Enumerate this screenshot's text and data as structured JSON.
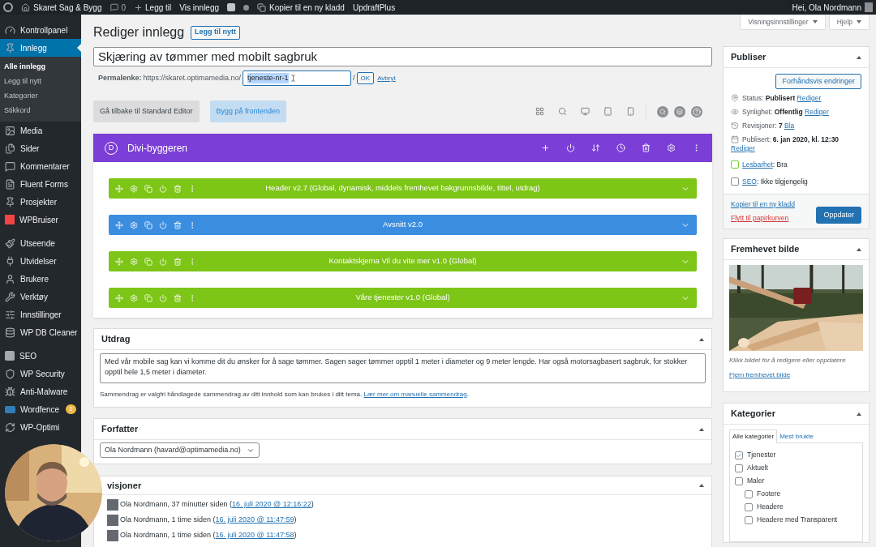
{
  "admin_bar": {
    "site": "Skaret Sag & Bygg",
    "comments": "0",
    "new": "Legg til",
    "view": "Vis innlegg",
    "copy": "Kopier til en ny kladd",
    "plugin": "UpdraftPlus",
    "greeting": "Hei, Ola Nordmann"
  },
  "sidebar": {
    "groups": [
      {
        "items": [
          {
            "label": "Kontrollpanel",
            "selected": false
          },
          {
            "label": "Innlegg",
            "selected": true,
            "children": [
              {
                "label": "Alle innlegg",
                "selected": true
              },
              {
                "label": "Legg til nytt",
                "selected": false
              },
              {
                "label": "Kategorier",
                "selected": false
              },
              {
                "label": "Stikkord",
                "selected": false
              }
            ]
          },
          {
            "label": "Media",
            "selected": false
          },
          {
            "label": "Sider",
            "selected": false
          },
          {
            "label": "Kommentarer",
            "selected": false
          },
          {
            "label": "Fluent Forms",
            "selected": false
          },
          {
            "label": "Prosjekter",
            "selected": false
          },
          {
            "label": "WPBruiser",
            "selected": false
          }
        ]
      },
      {
        "items": [
          {
            "label": "Utseende",
            "selected": false
          },
          {
            "label": "Utvidelser",
            "selected": false
          },
          {
            "label": "Brukere",
            "selected": false
          },
          {
            "label": "Verktøy",
            "selected": false
          },
          {
            "label": "Innstillinger",
            "selected": false
          },
          {
            "label": "WP DB Cleaner",
            "selected": false
          }
        ]
      },
      {
        "items": [
          {
            "label": "SEO",
            "selected": false
          },
          {
            "label": "WP Security",
            "selected": false
          },
          {
            "label": "Anti-Malware",
            "selected": false
          },
          {
            "label": "Wordfence",
            "selected": false,
            "badge": "2"
          },
          {
            "label": "WP-Optimi",
            "selected": false
          }
        ]
      }
    ]
  },
  "screen_options": [
    "Visningsinnstillinger",
    "Hjelp"
  ],
  "editor": {
    "heading": "Rediger innlegg",
    "add_new": "Legg til nytt",
    "title": "Skjæring av tømmer med mobilt sagbruk",
    "permalink": {
      "label": "Permalenke:",
      "base": "https://skaret.optimamedia.no/",
      "slug": "tjeneste-nr-1",
      "suffix": "/",
      "ok": "OK",
      "cancel": "Avbryt"
    },
    "buttons": [
      {
        "label": "Gå tilbake til Standard Editor",
        "kind": "secondary"
      },
      {
        "label": "Bygg på frontenden",
        "kind": "primary"
      }
    ]
  },
  "divi": {
    "logo": "D",
    "title": "Divi-byggeren",
    "sections": [
      {
        "title": "Header v2.7 (Global, dynamisk, middels fremhevet bakgrunnsbilde, tittel, utdrag)",
        "color": "#7dc516"
      },
      {
        "title": "Avsnitt v2.0",
        "color": "#3b8de0"
      },
      {
        "title": "Kontaktskjema Vil du vite mer v1.0 (Global)",
        "color": "#7dc516"
      },
      {
        "title": "Våre tjenester v1.0 (Global)",
        "color": "#7dc516"
      }
    ]
  },
  "excerpt": {
    "title": "Utdrag",
    "text": "Med vår mobile sag kan vi komme dit du ønsker for å sage tømmer. Sagen sager tømmer opptil 1 meter i diameter og 9 meter lengde. Har også motorsagbasert sagbruk, for stokker opptil hele 1,5 meter i diameter.",
    "help": "Sammendrag er valgfri håndlagede sammendrag av ditt innhold som kan brukes i ditt tema.",
    "link": "Lær mer om manuelle sammendrag",
    "end": "."
  },
  "author": {
    "title": "Forfatter",
    "value": "Ola Nordmann (havard@optimamedia.no)"
  },
  "revisions": {
    "title": "visjoner",
    "items": [
      {
        "text": "Ola Nordmann, 37 minutter siden (",
        "link": "16. juli 2020 @ 12:16:22",
        "end": ")"
      },
      {
        "text": "Ola Nordmann, 1 time siden (",
        "link": "16. juli 2020 @ 11:47:59",
        "end": ")"
      },
      {
        "text": "Ola Nordmann, 1 time siden (",
        "link": "16. juli 2020 @ 11:47:58",
        "end": ")"
      }
    ]
  },
  "publish": {
    "title": "Publiser",
    "preview": "Forhåndsvis endringer",
    "rows": [
      {
        "label": "Status:",
        "value": "Publisert",
        "link": "Rediger"
      },
      {
        "label": "Synlighet:",
        "value": "Offentlig",
        "link": "Rediger"
      },
      {
        "label": "Revisjoner:",
        "value": "7",
        "link": "Bla"
      },
      {
        "label": "Publisert:",
        "value": "6. jan 2020, kl. 12:30",
        "link": "Rediger"
      }
    ],
    "yoast": [
      {
        "link": "Lesbarhet",
        "sep": ":",
        "value": "Bra",
        "color": "#7ad03a"
      },
      {
        "link": "SEO",
        "sep": ":",
        "value": "Ikke tilgjengelig",
        "color": "#8c8f94"
      }
    ],
    "copy": "Kopier til en ny kladd",
    "trash": "Flytt til papirkurven",
    "update": "Oppdater"
  },
  "featured": {
    "title": "Fremhevet bilde",
    "caption": "Klikk bildet for å redigere eller oppdatere",
    "remove": "Fjern fremhevet bilde"
  },
  "categories": {
    "title": "Kategorier",
    "tabs": [
      {
        "label": "Alle kategorier",
        "selected": true
      },
      {
        "label": "Mest brukte",
        "selected": false
      }
    ],
    "items": [
      {
        "label": "Tjenester",
        "checked": true
      },
      {
        "label": "Aktuelt",
        "checked": false
      },
      {
        "label": "Maler",
        "checked": false,
        "children": [
          {
            "label": "Footere",
            "checked": false
          },
          {
            "label": "Headere",
            "checked": false
          },
          {
            "label": "Headere med Transparent",
            "checked": false
          }
        ]
      }
    ]
  }
}
